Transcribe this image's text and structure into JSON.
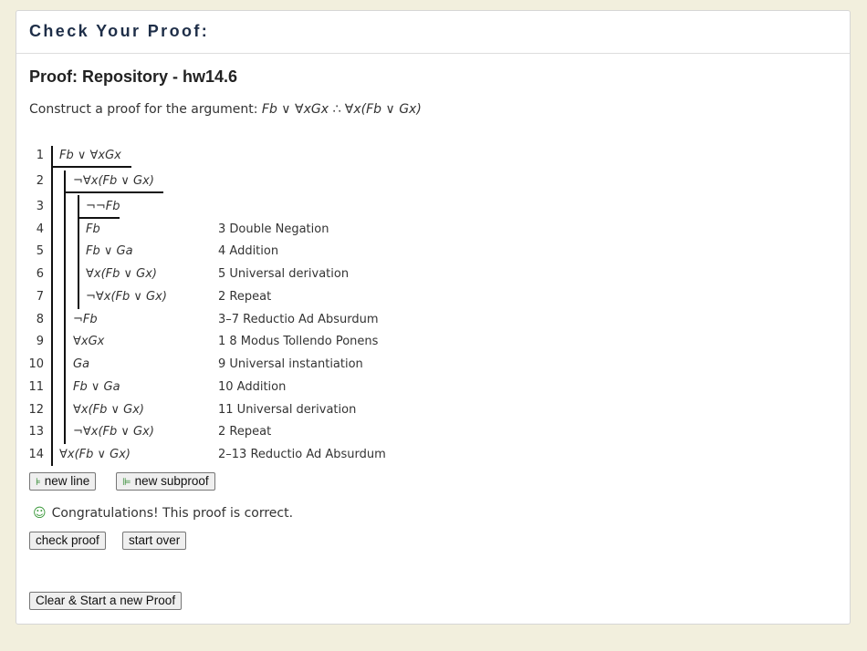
{
  "header": {
    "title": "Check Your Proof:"
  },
  "proof_title": "Proof: Repository - hw14.6",
  "construct": {
    "prefix": "Construct a proof for the argument: ",
    "argument": "Fb ∨ ∀xGx ∴ ∀x(Fb ∨ Gx)"
  },
  "lines": [
    {
      "num": "1",
      "formula": "Fb ∨ ∀xGx",
      "just": ""
    },
    {
      "num": "2",
      "formula": "¬∀x(Fb ∨ Gx)",
      "just": ""
    },
    {
      "num": "3",
      "formula": "¬¬Fb",
      "just": ""
    },
    {
      "num": "4",
      "formula": "Fb",
      "just": "3 Double Negation"
    },
    {
      "num": "5",
      "formula": "Fb ∨ Ga",
      "just": "4 Addition"
    },
    {
      "num": "6",
      "formula": "∀x(Fb ∨ Gx)",
      "just": "5 Universal derivation"
    },
    {
      "num": "7",
      "formula": "¬∀x(Fb ∨ Gx)",
      "just": "2 Repeat"
    },
    {
      "num": "8",
      "formula": "¬Fb",
      "just": "3–7 Reductio Ad Absurdum"
    },
    {
      "num": "9",
      "formula": "∀xGx",
      "just": "1 8 Modus Tollendo Ponens"
    },
    {
      "num": "10",
      "formula": "Ga",
      "just": "9 Universal instantiation"
    },
    {
      "num": "11",
      "formula": "Fb ∨ Ga",
      "just": "10 Addition"
    },
    {
      "num": "12",
      "formula": "∀x(Fb ∨ Gx)",
      "just": "11 Universal derivation"
    },
    {
      "num": "13",
      "formula": "¬∀x(Fb ∨ Gx)",
      "just": "2 Repeat"
    },
    {
      "num": "14",
      "formula": "∀x(Fb ∨ Gx)",
      "just": "2–13 Reductio Ad Absurdum"
    }
  ],
  "buttons": {
    "new_line": "new line",
    "new_subproof": "new subproof",
    "check_proof": "check proof",
    "start_over": "start over",
    "clear_start": "Clear & Start a new Proof"
  },
  "icons": {
    "new_line": "new-line-icon",
    "new_subproof": "new-subproof-icon",
    "smile": "smile-icon"
  },
  "status": {
    "message": "Congratulations! This proof is correct."
  },
  "colors": {
    "background": "#f2efdd",
    "title": "#1e2e48",
    "success": "#3d9a3d"
  }
}
